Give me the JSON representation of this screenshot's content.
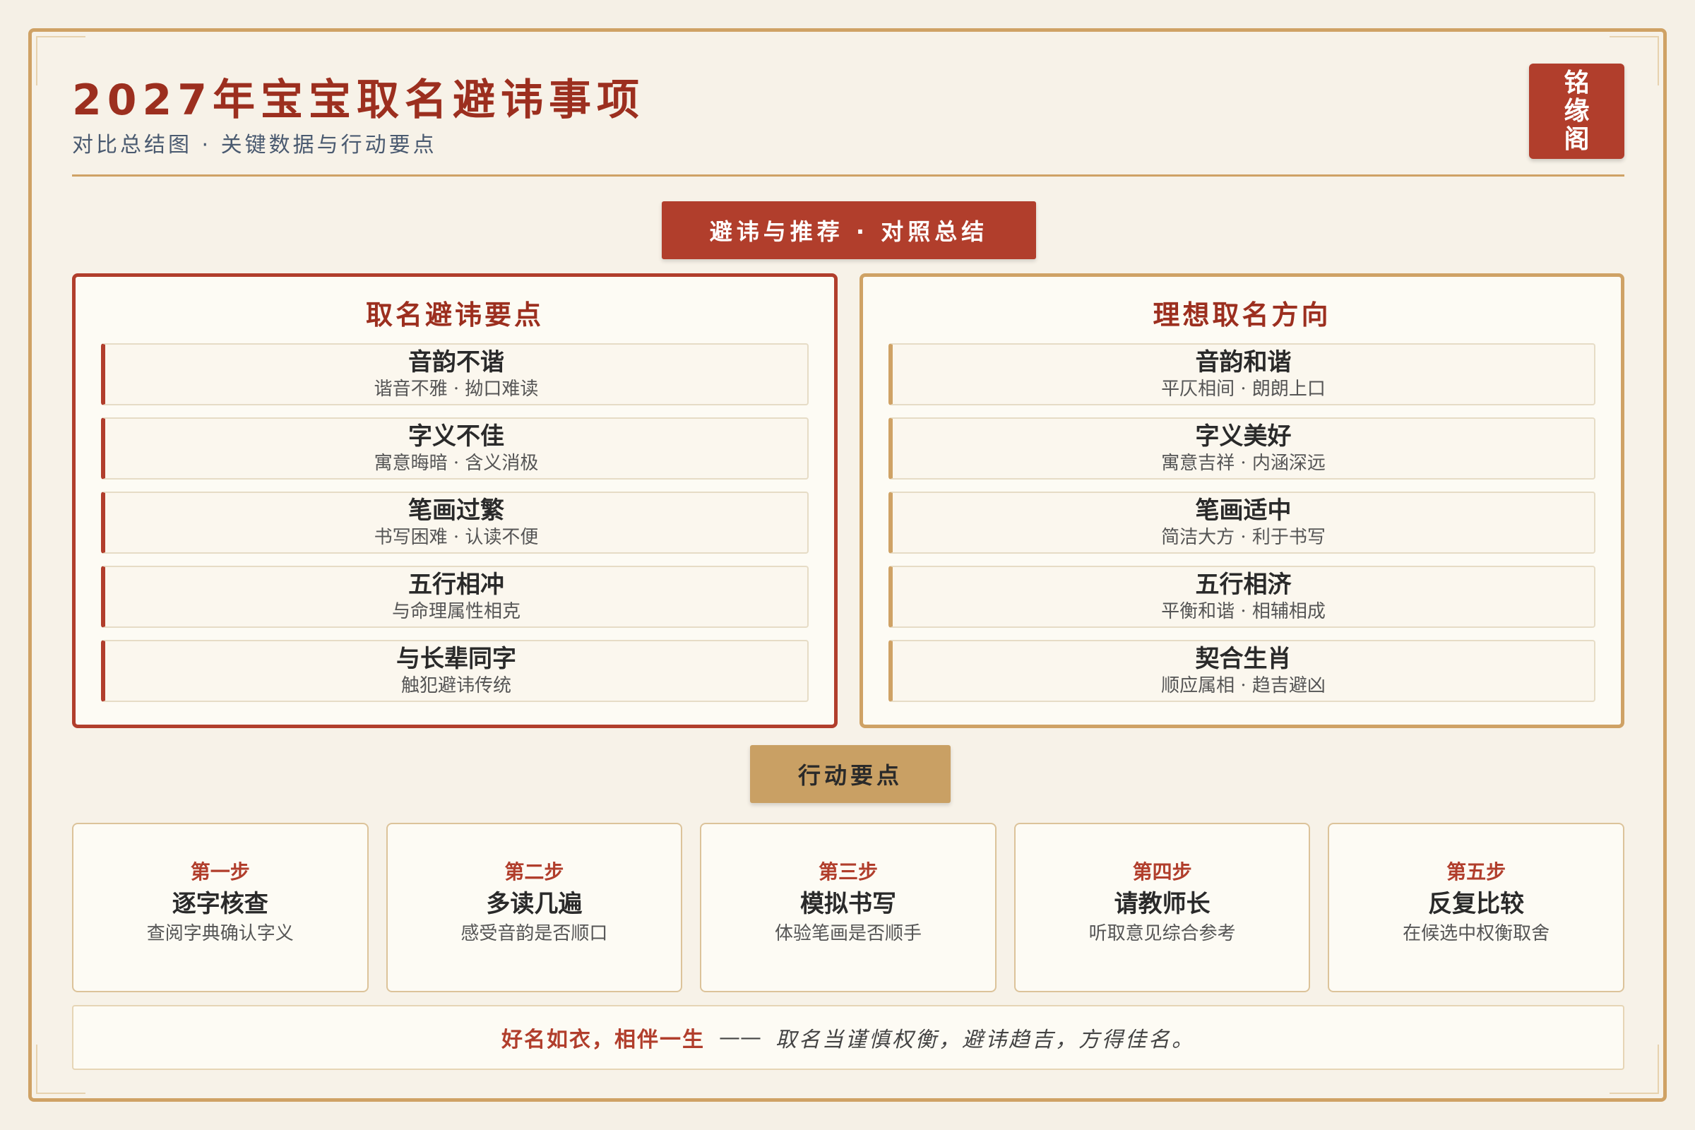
{
  "header": {
    "title": "2027年宝宝取名避讳事项",
    "subtitle": "对比总结图 · 关键数据与行动要点",
    "seal_chars": [
      "铭",
      "缘",
      "阁"
    ]
  },
  "banner": {
    "label": "避讳与推荐 · 对照总结"
  },
  "avoid_panel": {
    "title": "取名避讳要点",
    "items": [
      {
        "title": "音韵不谐",
        "desc": "谐音不雅 · 拗口难读"
      },
      {
        "title": "字义不佳",
        "desc": "寓意晦暗 · 含义消极"
      },
      {
        "title": "笔画过繁",
        "desc": "书写困难 · 认读不便"
      },
      {
        "title": "五行相冲",
        "desc": "与命理属性相克"
      },
      {
        "title": "与长辈同字",
        "desc": "触犯避讳传统"
      }
    ]
  },
  "ideal_panel": {
    "title": "理想取名方向",
    "items": [
      {
        "title": "音韵和谐",
        "desc": "平仄相间 · 朗朗上口"
      },
      {
        "title": "字义美好",
        "desc": "寓意吉祥 · 内涵深远"
      },
      {
        "title": "笔画适中",
        "desc": "简洁大方 · 利于书写"
      },
      {
        "title": "五行相济",
        "desc": "平衡和谐 · 相辅相成"
      },
      {
        "title": "契合生肖",
        "desc": "顺应属相 · 趋吉避凶"
      }
    ]
  },
  "action": {
    "label": "行动要点",
    "steps": [
      {
        "num": "第一步",
        "title": "逐字核查",
        "desc": "查阅字典确认字义"
      },
      {
        "num": "第二步",
        "title": "多读几遍",
        "desc": "感受音韵是否顺口"
      },
      {
        "num": "第三步",
        "title": "模拟书写",
        "desc": "体验笔画是否顺手"
      },
      {
        "num": "第四步",
        "title": "请教师长",
        "desc": "听取意见综合参考"
      },
      {
        "num": "第五步",
        "title": "反复比较",
        "desc": "在候选中权衡取舍"
      }
    ]
  },
  "footer": {
    "strong": "好名如衣，相伴一生",
    "dash": "——",
    "text": "取名当谨慎权衡，避讳趋吉，方得佳名。"
  },
  "colors": {
    "accent_red": "#b13e2c",
    "accent_gold": "#cfa265",
    "title_red": "#9c2f1f",
    "background": "#f5f0e6"
  }
}
